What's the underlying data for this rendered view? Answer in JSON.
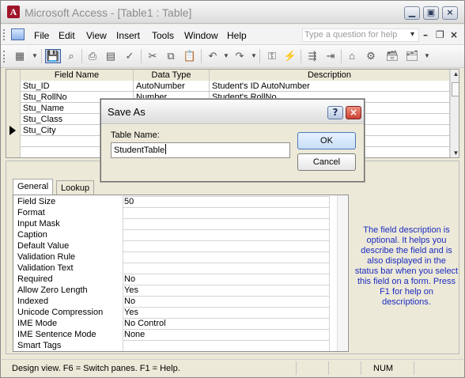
{
  "window": {
    "title": "Microsoft Access - [Table1 : Table]",
    "app_icon_letter": "A",
    "minimize_label": "▁",
    "maximize_label": "▣",
    "close_label": "×"
  },
  "menubar": {
    "items": [
      {
        "label": "File"
      },
      {
        "label": "Edit"
      },
      {
        "label": "View"
      },
      {
        "label": "Insert"
      },
      {
        "label": "Tools"
      },
      {
        "label": "Window"
      },
      {
        "label": "Help"
      }
    ],
    "question_placeholder": "Type a question for help",
    "question_arrow": "▾",
    "mdi_min": "–",
    "mdi_restore": "❐",
    "mdi_close": "×"
  },
  "toolbar": {
    "buttons": [
      {
        "name": "view-icon",
        "glyph": "▦"
      },
      {
        "name": "save-icon",
        "glyph": "💾"
      },
      {
        "name": "search-icon",
        "glyph": "⌕"
      },
      {
        "name": "print-icon",
        "glyph": "⎙"
      },
      {
        "name": "print-preview-icon",
        "glyph": "▤"
      },
      {
        "name": "spelling-icon",
        "glyph": "✓"
      },
      {
        "name": "cut-icon",
        "glyph": "✂"
      },
      {
        "name": "copy-icon",
        "glyph": "⧉"
      },
      {
        "name": "paste-icon",
        "glyph": "📋"
      },
      {
        "name": "undo-icon",
        "glyph": "↶"
      },
      {
        "name": "redo-icon",
        "glyph": "↷"
      },
      {
        "name": "key-icon",
        "glyph": "⚿"
      },
      {
        "name": "builder-icon",
        "glyph": "⚡"
      },
      {
        "name": "insert-rows-icon",
        "glyph": "⇶"
      },
      {
        "name": "delete-rows-icon",
        "glyph": "⇥"
      },
      {
        "name": "properties-icon",
        "glyph": "⌂"
      },
      {
        "name": "indexes-icon",
        "glyph": "⚙"
      },
      {
        "name": "database-window-icon",
        "glyph": "🗃"
      },
      {
        "name": "new-object-icon",
        "glyph": "🗂"
      }
    ]
  },
  "design_grid": {
    "headers": [
      "Field Name",
      "Data Type",
      "Description"
    ],
    "rows": [
      {
        "field": "Stu_ID",
        "type": "AutoNumber",
        "description": "Student's ID AutoNumber"
      },
      {
        "field": "Stu_RollNo",
        "type": "Number",
        "description": "Student's RollNo"
      },
      {
        "field": "Stu_Name",
        "type": "",
        "description": ""
      },
      {
        "field": "Stu_Class",
        "type": "",
        "description": ""
      },
      {
        "field": "Stu_City",
        "type": "",
        "description": ""
      },
      {
        "field": "",
        "type": "",
        "description": ""
      },
      {
        "field": "",
        "type": "",
        "description": ""
      }
    ],
    "current_row_index": 4,
    "scroll_up_glyph": "▲",
    "scroll_down_glyph": "▼"
  },
  "field_properties": {
    "tabs": [
      {
        "label": "General",
        "active": true
      },
      {
        "label": "Lookup",
        "active": false
      }
    ],
    "properties": [
      {
        "label": "Field Size",
        "value": "50"
      },
      {
        "label": "Format",
        "value": ""
      },
      {
        "label": "Input Mask",
        "value": ""
      },
      {
        "label": "Caption",
        "value": ""
      },
      {
        "label": "Default Value",
        "value": ""
      },
      {
        "label": "Validation Rule",
        "value": ""
      },
      {
        "label": "Validation Text",
        "value": ""
      },
      {
        "label": "Required",
        "value": "No"
      },
      {
        "label": "Allow Zero Length",
        "value": "Yes"
      },
      {
        "label": "Indexed",
        "value": "No"
      },
      {
        "label": "Unicode Compression",
        "value": "Yes"
      },
      {
        "label": "IME Mode",
        "value": "No Control"
      },
      {
        "label": "IME Sentence Mode",
        "value": "None"
      },
      {
        "label": "Smart Tags",
        "value": ""
      }
    ],
    "help_text": "The field description is optional.  It helps you describe the field and is also displayed in the status bar when you select this field on a form.  Press F1 for help on descriptions."
  },
  "status_bar": {
    "text": "Design view.  F6 = Switch panes.  F1 = Help.",
    "num_indicator": "NUM"
  },
  "dialog": {
    "title": "Save As",
    "help_glyph": "?",
    "close_glyph": "×",
    "table_name_label": "Table Name:",
    "table_name_value": "StudentTable",
    "ok_label": "OK",
    "cancel_label": "Cancel"
  }
}
